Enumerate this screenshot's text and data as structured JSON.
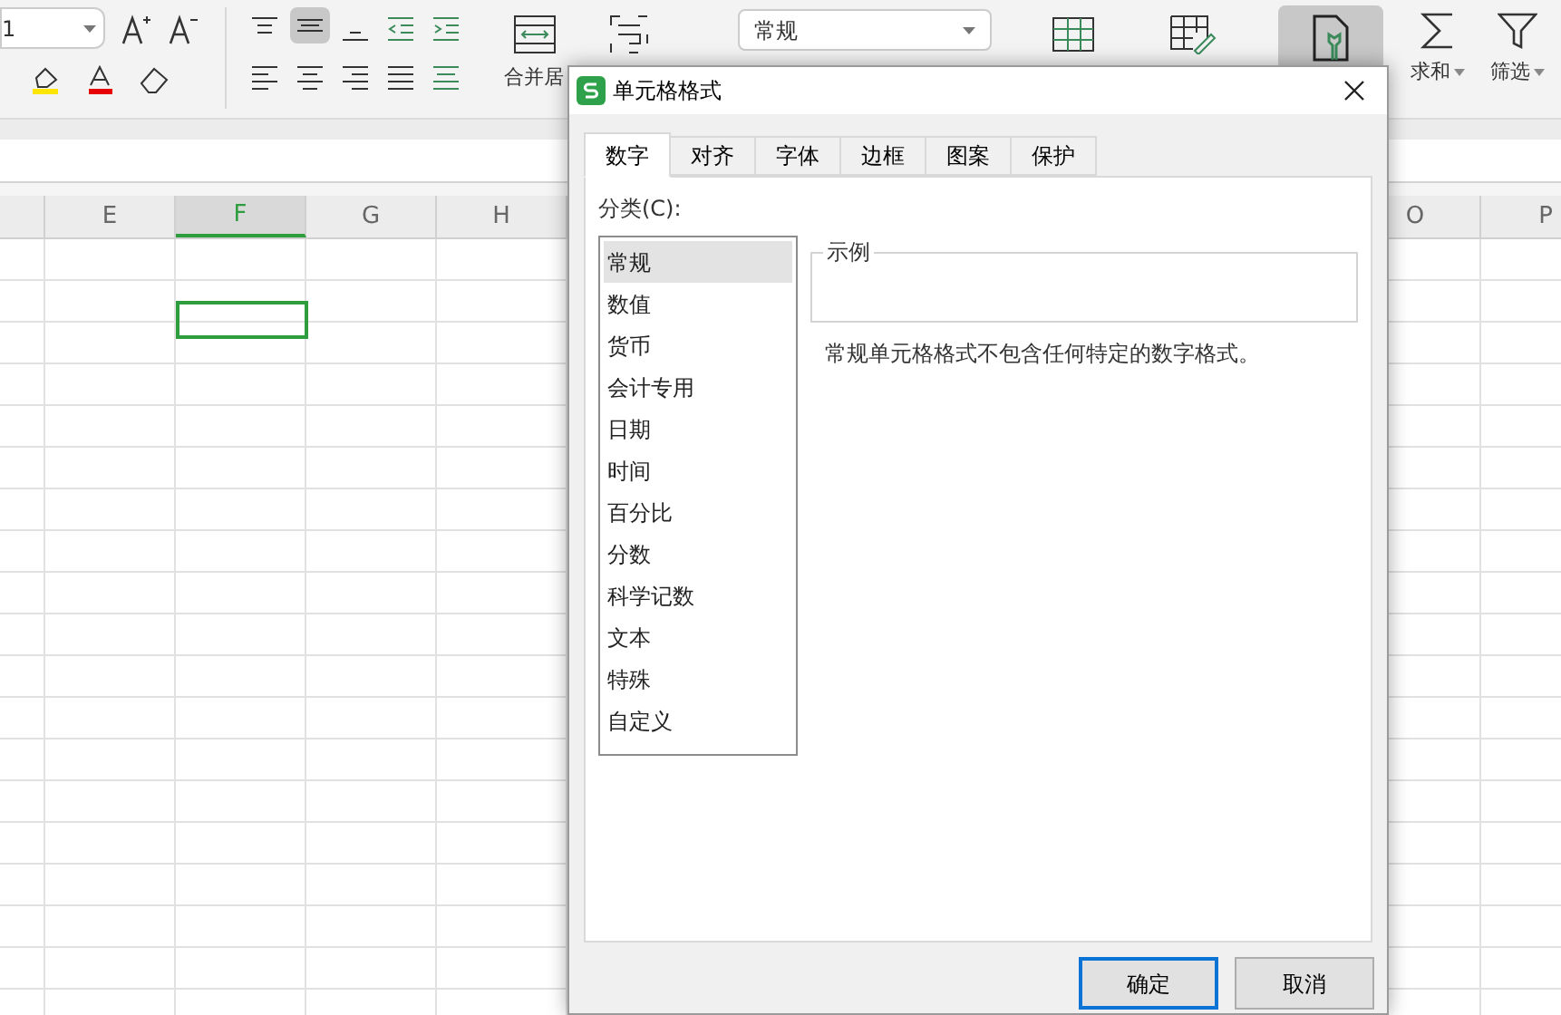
{
  "ribbon": {
    "font_size": "1",
    "merge_label": "合并居",
    "number_format": "常规",
    "sum_label": "求和",
    "filter_label": "筛选"
  },
  "columns": [
    {
      "label": "E",
      "selected": false
    },
    {
      "label": "F",
      "selected": true
    },
    {
      "label": "G",
      "selected": false
    },
    {
      "label": "H",
      "selected": false
    },
    {
      "label": "O",
      "selected": false
    },
    {
      "label": "P",
      "selected": false
    }
  ],
  "dialog": {
    "title": "单元格格式",
    "tabs": [
      {
        "label": "数字",
        "selected": true
      },
      {
        "label": "对齐",
        "selected": false
      },
      {
        "label": "字体",
        "selected": false
      },
      {
        "label": "边框",
        "selected": false
      },
      {
        "label": "图案",
        "selected": false
      },
      {
        "label": "保护",
        "selected": false
      }
    ],
    "category_label": "分类(C):",
    "categories": [
      {
        "label": "常规",
        "selected": true
      },
      {
        "label": "数值",
        "selected": false
      },
      {
        "label": "货币",
        "selected": false
      },
      {
        "label": "会计专用",
        "selected": false
      },
      {
        "label": "日期",
        "selected": false
      },
      {
        "label": "时间",
        "selected": false
      },
      {
        "label": "百分比",
        "selected": false
      },
      {
        "label": "分数",
        "selected": false
      },
      {
        "label": "科学记数",
        "selected": false
      },
      {
        "label": "文本",
        "selected": false
      },
      {
        "label": "特殊",
        "selected": false
      },
      {
        "label": "自定义",
        "selected": false
      }
    ],
    "sample_label": "示例",
    "description": "常规单元格格式不包含任何特定的数字格式。",
    "buttons": [
      {
        "label": "确定",
        "kind": "default"
      },
      {
        "label": "取消",
        "kind": "normal"
      }
    ]
  }
}
